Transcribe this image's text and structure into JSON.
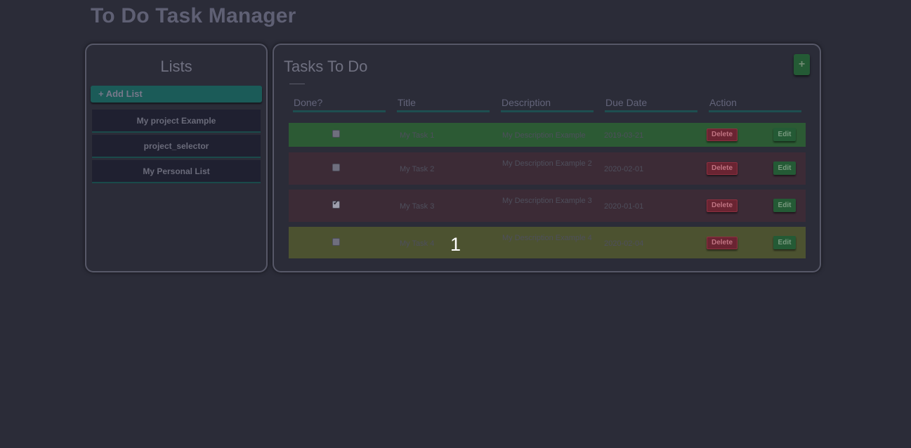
{
  "app": {
    "title": "To Do Task Manager"
  },
  "lists": {
    "title": "Lists",
    "add_label": "+ Add List",
    "items": [
      {
        "label": "My project Example"
      },
      {
        "label": "project_selector"
      },
      {
        "label": "My Personal List"
      }
    ]
  },
  "tasks": {
    "title": "Tasks To Do",
    "add_button_label": "+",
    "columns": [
      "Done?",
      "Title",
      "Description",
      "Due Date",
      "Action"
    ],
    "delete_label": "Delete",
    "edit_label": "Edit",
    "rows": [
      {
        "done": false,
        "title": "My Task 1",
        "description": "My Description Example",
        "due_date": "2019-03-21",
        "status_color": "#2c5a34"
      },
      {
        "done": false,
        "title": "My Task 2",
        "description": "My Description Example 2",
        "due_date": "2020-02-01",
        "status_color": "#3c2b36"
      },
      {
        "done": true,
        "title": "My Task 3",
        "description": "My Description Example 3",
        "due_date": "2020-01-01",
        "status_color": "#3c2b36"
      },
      {
        "done": false,
        "title": "My Task 4",
        "description": "My Description Example 4",
        "due_date": "2020-02-04",
        "status_color": "#4c5230"
      }
    ]
  },
  "overlay": {
    "step_number": "1"
  }
}
